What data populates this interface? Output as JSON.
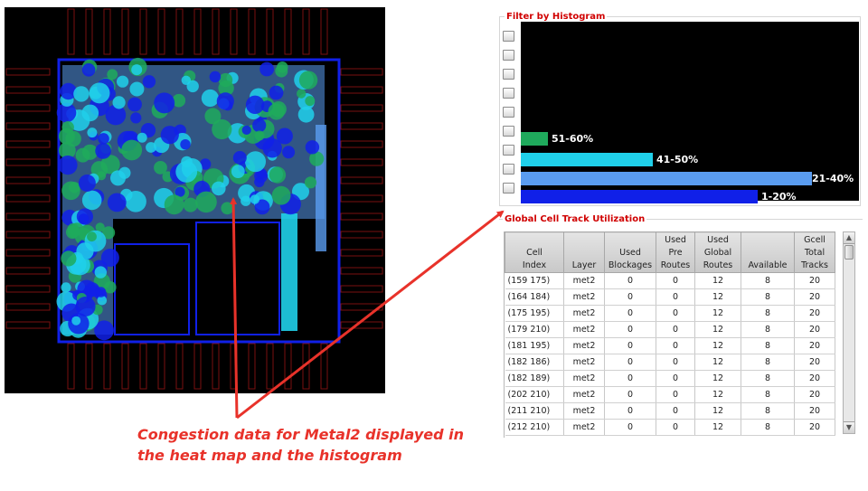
{
  "histogram": {
    "title": "Filter by Histogram",
    "checkbox_count": 9,
    "bars": [
      {
        "label": "51-60%",
        "fraction": 0.08,
        "color": "#1faa5c"
      },
      {
        "label": "41-50%",
        "fraction": 0.39,
        "color": "#20d0ea"
      },
      {
        "label": "21-40%",
        "fraction": 0.86,
        "color": "#5a9cf0"
      },
      {
        "label": "1-20%",
        "fraction": 0.7,
        "color": "#1020e8"
      }
    ]
  },
  "table": {
    "title": "Global Cell Track Utilization",
    "headers": [
      [
        "Cell",
        "Index"
      ],
      [
        "Layer"
      ],
      [
        "Used",
        "Blockages"
      ],
      [
        "Used",
        "Pre",
        "Routes"
      ],
      [
        "Used",
        "Global",
        "Routes"
      ],
      [
        "Available"
      ],
      [
        "Gcell",
        "Total",
        "Tracks"
      ]
    ],
    "rows": [
      [
        "(159 175)",
        "met2",
        "0",
        "0",
        "12",
        "8",
        "20"
      ],
      [
        "(164 184)",
        "met2",
        "0",
        "0",
        "12",
        "8",
        "20"
      ],
      [
        "(175 195)",
        "met2",
        "0",
        "0",
        "12",
        "8",
        "20"
      ],
      [
        "(179 210)",
        "met2",
        "0",
        "0",
        "12",
        "8",
        "20"
      ],
      [
        "(181 195)",
        "met2",
        "0",
        "0",
        "12",
        "8",
        "20"
      ],
      [
        "(182 186)",
        "met2",
        "0",
        "0",
        "12",
        "8",
        "20"
      ],
      [
        "(182 189)",
        "met2",
        "0",
        "0",
        "12",
        "8",
        "20"
      ],
      [
        "(202 210)",
        "met2",
        "0",
        "0",
        "12",
        "8",
        "20"
      ],
      [
        "(211 210)",
        "met2",
        "0",
        "0",
        "12",
        "8",
        "20"
      ],
      [
        "(212 210)",
        "met2",
        "0",
        "0",
        "12",
        "8",
        "20"
      ]
    ]
  },
  "annotation": {
    "caption_line1": "Congestion data for Metal2 displayed in",
    "caption_line2": "the heat map and the histogram",
    "color": "#e8322a"
  },
  "heatmap": {
    "colors": {
      "background": "#000000",
      "pins": "#7a1010",
      "low": "#1020e8",
      "mid_low": "#5a9cf0",
      "mid_high": "#20d0ea",
      "high": "#1faa5c"
    }
  }
}
